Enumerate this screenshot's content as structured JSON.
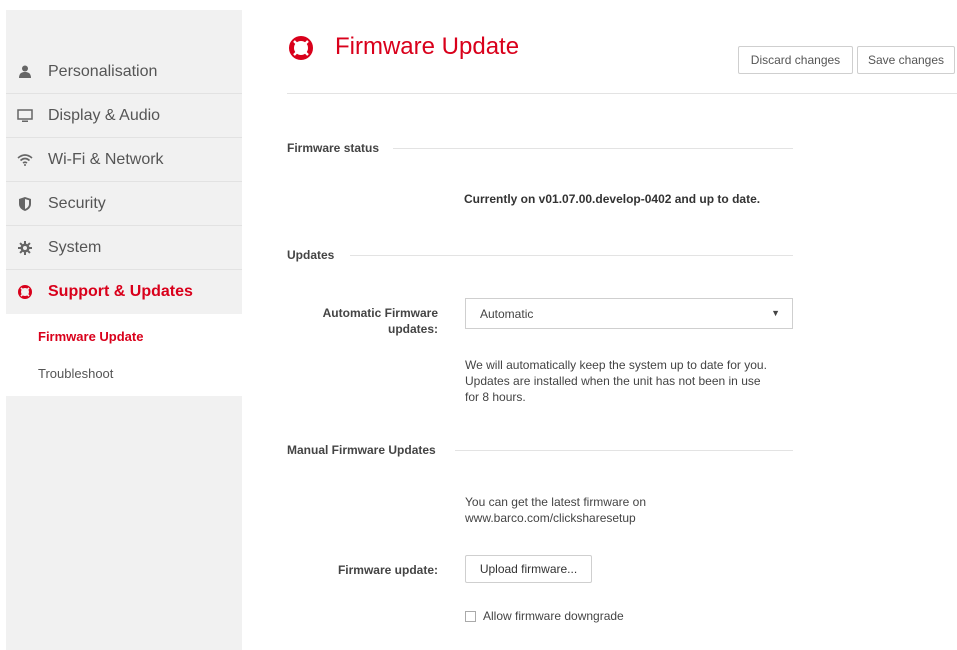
{
  "sidebar": {
    "items": [
      {
        "label": "Personalisation",
        "icon": "user-icon"
      },
      {
        "label": "Display & Audio",
        "icon": "monitor-icon"
      },
      {
        "label": "Wi-Fi & Network",
        "icon": "wifi-icon"
      },
      {
        "label": "Security",
        "icon": "shield-icon"
      },
      {
        "label": "System",
        "icon": "gear-icon"
      },
      {
        "label": "Support & Updates",
        "icon": "lifebuoy-icon",
        "active": true
      }
    ],
    "subitems": [
      {
        "label": "Firmware Update",
        "active": true
      },
      {
        "label": "Troubleshoot"
      }
    ]
  },
  "header": {
    "title": "Firmware Update",
    "icon": "lifebuoy-icon",
    "discard_label": "Discard changes",
    "save_label": "Save changes"
  },
  "firmware_status": {
    "title": "Firmware status",
    "text": "Currently on v01.07.00.develop-0402 and up to date."
  },
  "updates": {
    "title": "Updates",
    "auto_label_line1": "Automatic Firmware",
    "auto_label_line2": "updates:",
    "auto_value": "Automatic",
    "help_line1": "We will automatically keep the system up to date for you.",
    "help_line2": "Updates are installed when the unit has not been in use",
    "help_line3": "for 8 hours."
  },
  "manual": {
    "title": "Manual Firmware Updates",
    "info_line1": "You can get the latest firmware on",
    "info_line2": "www.barco.com/clicksharesetup",
    "field_label": "Firmware update:",
    "upload_label": "Upload firmware...",
    "downgrade_label": "Allow firmware downgrade"
  },
  "colors": {
    "accent": "#d9001b",
    "sidebar_bg": "#f1f1f1"
  }
}
